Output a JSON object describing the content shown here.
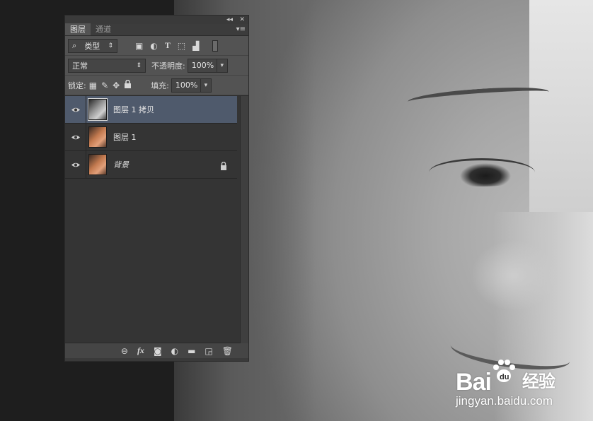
{
  "panel": {
    "window_controls": {
      "collapse": "◂◂",
      "close": "✕"
    },
    "tabs": [
      {
        "label": "图层",
        "active": true
      },
      {
        "label": "通道",
        "active": false
      }
    ],
    "menu_icon": "panel-menu-icon",
    "filter": {
      "label": "类型",
      "icons": [
        "image-filter-icon",
        "adjustment-filter-icon",
        "type-filter-icon",
        "shape-filter-icon",
        "smartobject-filter-icon",
        "toggle-filter-icon"
      ]
    },
    "blend": {
      "mode": "正常",
      "opacity_label": "不透明度:",
      "opacity_value": "100%"
    },
    "lock": {
      "label": "锁定:",
      "fill_label": "填充:",
      "fill_value": "100%",
      "icons": [
        "lock-transparent-icon",
        "lock-image-icon",
        "lock-position-icon",
        "lock-all-icon"
      ]
    },
    "layers": [
      {
        "name": "图层 1 拷贝",
        "selected": true,
        "visible": true,
        "locked": false,
        "thumbnail": "grayscale"
      },
      {
        "name": "图层 1",
        "selected": false,
        "visible": true,
        "locked": false,
        "thumbnail": "color"
      },
      {
        "name": "背景",
        "selected": false,
        "visible": true,
        "locked": true,
        "thumbnail": "color"
      }
    ],
    "footer_icons": [
      "link-layers-icon",
      "fx-icon",
      "layer-mask-icon",
      "adjustment-layer-icon",
      "new-group-icon",
      "new-layer-icon",
      "delete-layer-icon"
    ],
    "fx_label": "fx"
  },
  "watermark": {
    "brand": "Bai du",
    "brand_cn": "经验",
    "url": "jingyan.baidu.com"
  },
  "colors": {
    "panel_bg": "#535353",
    "layers_bg": "#343434",
    "selected_layer": "#4f5a6c"
  }
}
